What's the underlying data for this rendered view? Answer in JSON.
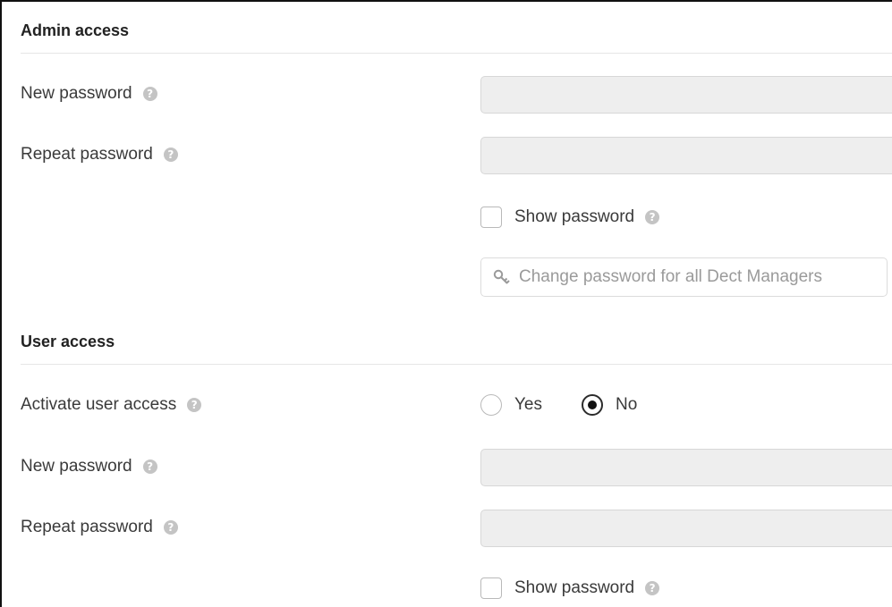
{
  "admin_access": {
    "title": "Admin access",
    "new_password": {
      "label": "New password",
      "value": "",
      "help_icon": "help-icon"
    },
    "repeat_password": {
      "label": "Repeat password",
      "value": "",
      "help_icon": "help-icon"
    },
    "show_password": {
      "label": "Show password",
      "checked": false
    },
    "change_all_button": {
      "label": "Change password for all Dect Managers",
      "icon": "key-icon"
    }
  },
  "user_access": {
    "title": "User access",
    "activate": {
      "label": "Activate user access",
      "options": [
        {
          "label": "Yes",
          "selected": false
        },
        {
          "label": "No",
          "selected": true
        }
      ]
    },
    "new_password": {
      "label": "New password",
      "value": "",
      "help_icon": "help-icon"
    },
    "repeat_password": {
      "label": "Repeat password",
      "value": "",
      "help_icon": "help-icon"
    },
    "show_password": {
      "label": "Show password",
      "checked": false
    }
  },
  "colors": {
    "input_background": "#eeeeee",
    "help_icon": "#c4c4c4",
    "radio_selected": "#111111"
  }
}
